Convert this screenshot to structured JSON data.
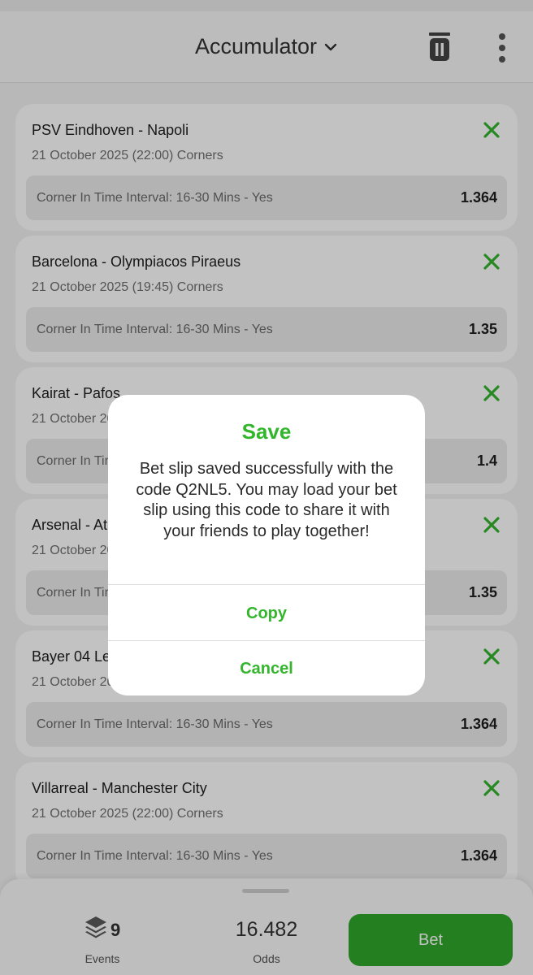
{
  "header": {
    "title": "Accumulator",
    "icons": [
      "chevron-down-icon",
      "trash-icon",
      "more-vertical-icon"
    ]
  },
  "bets": [
    {
      "match": "PSV Eindhoven - Napoli",
      "info": "21 October 2025 (22:00) Corners",
      "selection": "Corner In Time Interval: 16-30 Mins - Yes",
      "odds": "1.364"
    },
    {
      "match": "Barcelona - Olympiacos Piraeus",
      "info": "21 October 2025 (19:45) Corners",
      "selection": "Corner In Time Interval: 16-30 Mins - Yes",
      "odds": "1.35"
    },
    {
      "match": "Kairat - Pafos",
      "info": "21 October 20",
      "selection": "Corner In Tir",
      "odds": "1.4"
    },
    {
      "match": "Arsenal - At",
      "info": "21 October 20",
      "selection": "Corner In Tir",
      "odds": "1.35"
    },
    {
      "match": "Bayer 04 Le",
      "info": "21 October 20",
      "selection": "Corner In Time Interval: 16-30 Mins - Yes",
      "odds": "1.364"
    },
    {
      "match": "Villarreal - Manchester City",
      "info": "21 October 2025 (22:00) Corners",
      "selection": "Corner In Time Interval: 16-30 Mins - Yes",
      "odds": "1.364"
    }
  ],
  "footer": {
    "events_count": "9",
    "events_label": "Events",
    "odds_value": "16.482",
    "odds_label": "Odds",
    "bet_label": "Bet"
  },
  "dialog": {
    "title": "Save",
    "message": "Bet slip saved successfully with the code Q2NL5. You may load your bet slip using this code to share it with your friends to play together!",
    "copy_label": "Copy",
    "cancel_label": "Cancel"
  },
  "colors": {
    "accent_green": "#33b52c",
    "bet_button": "#2fa82a"
  }
}
